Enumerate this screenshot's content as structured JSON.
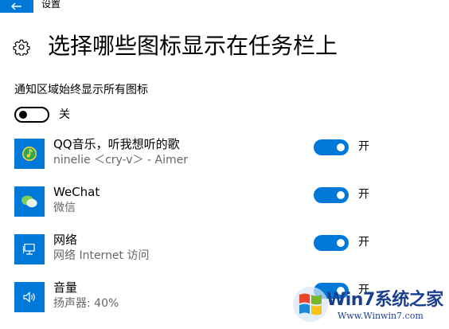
{
  "window": {
    "title": "设置",
    "back_icon": "back-arrow-icon"
  },
  "page": {
    "title": "选择哪些图标显示在任务栏上",
    "icon": "gear-icon"
  },
  "always_show": {
    "label": "通知区域始终显示所有图标",
    "state": "off",
    "state_label": "关"
  },
  "items": [
    {
      "name": "QQ音乐，听我想听的歌",
      "subtitle": "ninelie ＜cry-v＞ - Aimer",
      "icon": "qq-music-icon",
      "state": "on",
      "state_label": "开"
    },
    {
      "name": "WeChat",
      "subtitle": "微信",
      "icon": "wechat-icon",
      "state": "on",
      "state_label": "开"
    },
    {
      "name": "网络",
      "subtitle": "网络 Internet 访问",
      "icon": "network-icon",
      "state": "on",
      "state_label": "开"
    },
    {
      "name": "音量",
      "subtitle": "扬声器: 40%",
      "icon": "volume-icon",
      "state": "on",
      "state_label": "开"
    }
  ],
  "watermark": {
    "brand": "Win7系统之家",
    "url": "Www.Winwin7.com"
  },
  "colors": {
    "accent": "#0078d7",
    "secondary_text": "#666666",
    "watermark": "#1b3f8f"
  }
}
